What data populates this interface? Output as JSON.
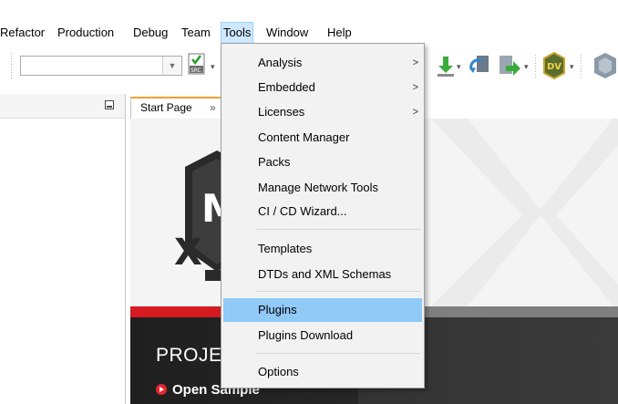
{
  "menubar": {
    "items": [
      "Refactor",
      "Production",
      "Debug",
      "Team",
      "Tools",
      "Window",
      "Help"
    ],
    "active": "Tools"
  },
  "toolbar": {
    "config_combo_value": "",
    "icons": [
      "src-build-icon",
      "download-icon",
      "reload-icon",
      "program-device-icon",
      "dv-icon",
      "mplab-icon"
    ]
  },
  "left_panel": {
    "title": ""
  },
  "editor_tabs": [
    {
      "label": "Start Page",
      "close": "»"
    }
  ],
  "start_page": {
    "section_title": "PROJE",
    "open_sample_label": "Open Sample",
    "colors": {
      "red_bar": "#d51a21",
      "dark": "#262626"
    }
  },
  "tools_menu": {
    "items": [
      {
        "label": "Analysis",
        "submenu": true
      },
      {
        "label": "Embedded",
        "submenu": true
      },
      {
        "label": "Licenses",
        "submenu": true
      },
      {
        "label": "Content Manager",
        "submenu": false
      },
      {
        "label": "Packs",
        "submenu": false
      },
      {
        "label": "Manage Network Tools",
        "submenu": false
      },
      {
        "label": "CI / CD Wizard...",
        "submenu": false
      },
      {
        "label": "Templates",
        "submenu": false
      },
      {
        "label": "DTDs and XML Schemas",
        "submenu": false
      },
      {
        "label": "Plugins",
        "submenu": false,
        "highlighted": true
      },
      {
        "label": "Plugins Download",
        "submenu": false
      },
      {
        "label": "Options",
        "submenu": false
      }
    ],
    "submenu_arrow": ">"
  }
}
